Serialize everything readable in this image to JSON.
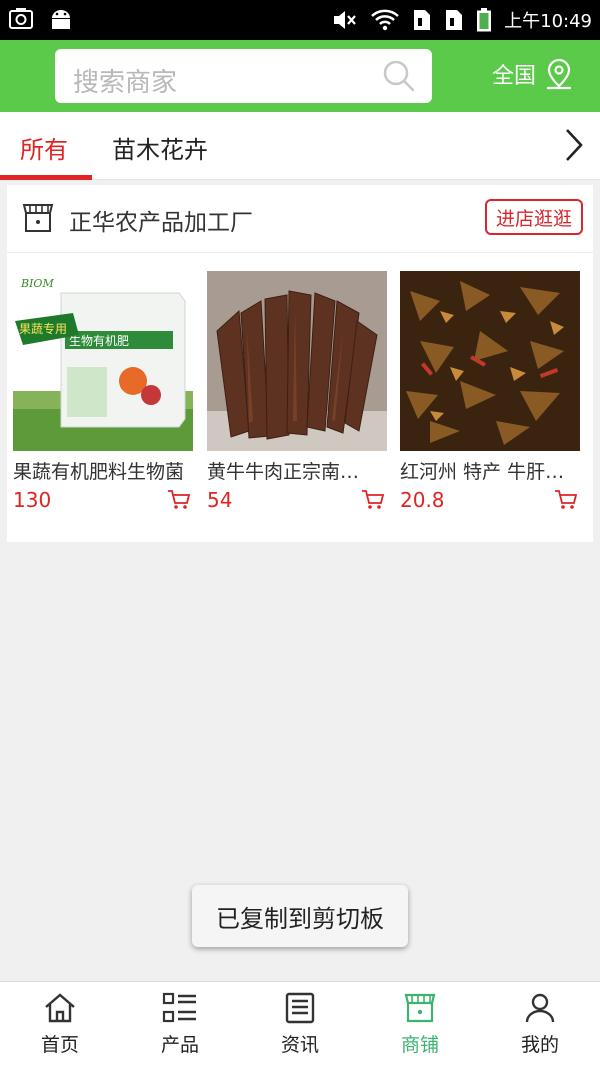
{
  "status_bar": {
    "time": "上午10:49"
  },
  "header": {
    "search_placeholder": "搜索商家",
    "region_label": "全国",
    "accent_color": "#5bc94a"
  },
  "tabs": [
    {
      "label": "所有",
      "active": true
    },
    {
      "label": "苗木花卉",
      "active": false
    }
  ],
  "shop": {
    "name": "正华农产品加工厂",
    "enter_button": "进店逛逛",
    "products": [
      {
        "name": "果蔬有机肥料生物菌",
        "price": "130"
      },
      {
        "name": "黄牛牛肉正宗南…",
        "price": "54"
      },
      {
        "name": "红河州 特产 牛肝…",
        "price": "20.8"
      }
    ],
    "product_image_texts": {
      "bag_brand": "BIOM",
      "bag_tag": "果蔬专用",
      "bag_title": "生物有机肥"
    }
  },
  "toast": "已复制到剪切板",
  "bottom_nav": [
    {
      "label": "首页",
      "icon": "home-icon",
      "active": false
    },
    {
      "label": "产品",
      "icon": "list-icon",
      "active": false
    },
    {
      "label": "资讯",
      "icon": "news-icon",
      "active": false
    },
    {
      "label": "商铺",
      "icon": "shop-icon",
      "active": true
    },
    {
      "label": "我的",
      "icon": "user-icon",
      "active": false
    }
  ]
}
